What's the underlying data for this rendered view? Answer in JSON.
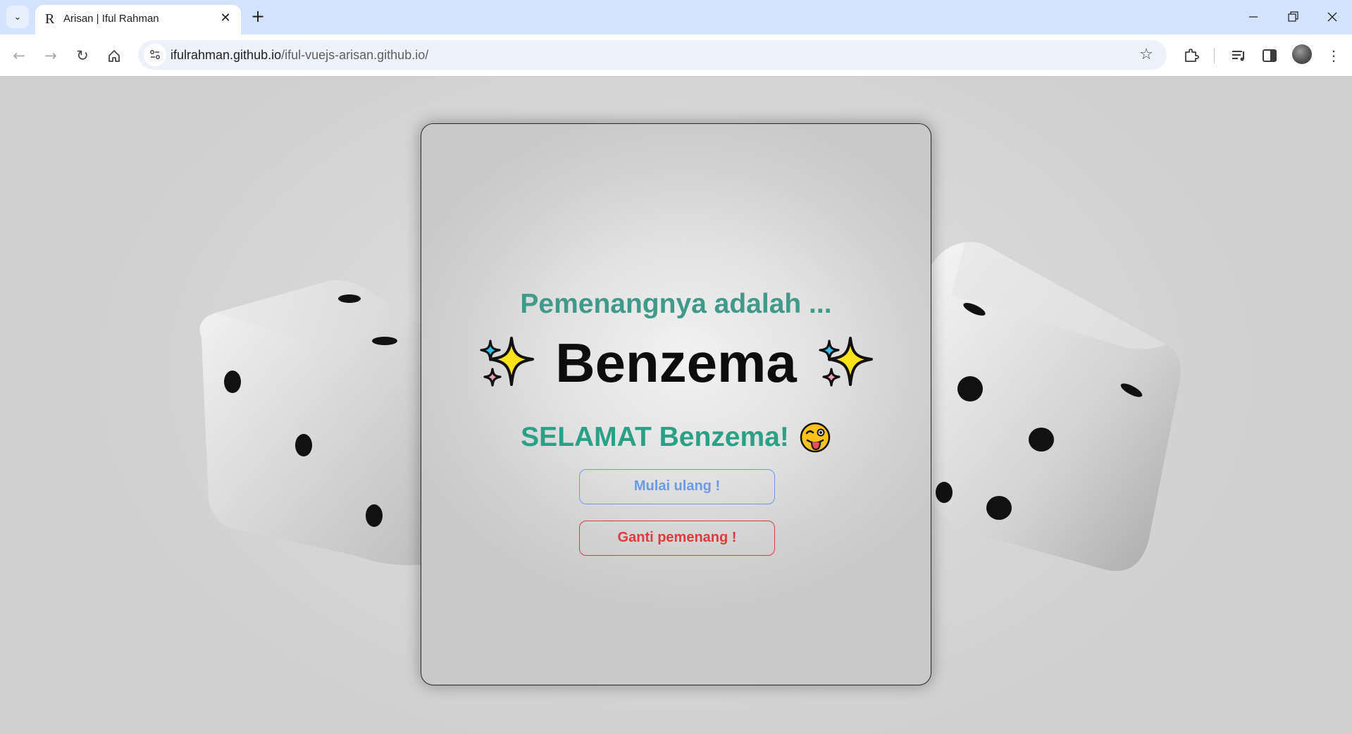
{
  "browser": {
    "tab_title": "Arisan | Iful Rahman",
    "favicon_letter": "R",
    "url_domain": "ifulrahman.github.io",
    "url_path": "/iful-vuejs-arisan.github.io/"
  },
  "card": {
    "heading": "Pemenangnya adalah ...",
    "winner_name": "Benzema",
    "congrats_text": "SELAMAT Benzema!",
    "restart_button": "Mulai ulang !",
    "change_winner_button": "Ganti pemenang !"
  },
  "colors": {
    "heading": "#3f9a8a",
    "congrats": "#2aa187",
    "restart_button": "#6b9ae6",
    "change_button": "#e0393e"
  },
  "icons": {
    "left_decor": "sparkles-icon",
    "right_decor": "sparkles-icon",
    "congrats_emoji": "winking-face-with-tongue-icon"
  }
}
